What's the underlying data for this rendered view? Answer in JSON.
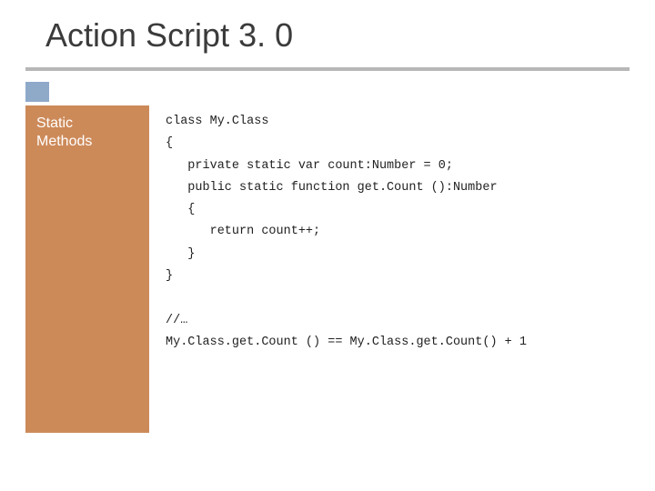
{
  "title": "Action Script 3. 0",
  "sidebar": {
    "line1": "Static",
    "line2": "Methods"
  },
  "code": {
    "l1": "class My.Class",
    "l2": "{",
    "l3": "   private static var count:Number = 0;",
    "l4": "   public static function get.Count ():Number",
    "l5": "   {",
    "l6": "      return count++;",
    "l7": "   }",
    "l8": "}",
    "l9": "",
    "l10": "//…",
    "l11": "My.Class.get.Count () == My.Class.get.Count() + 1"
  }
}
